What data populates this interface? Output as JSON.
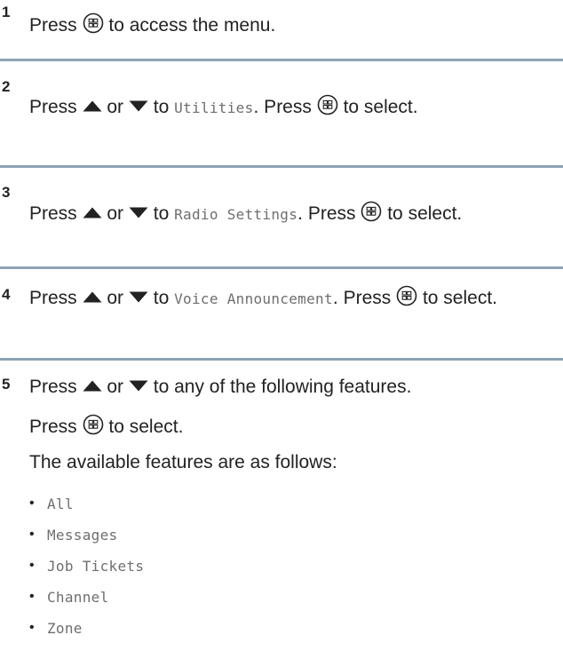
{
  "steps": [
    {
      "number": "1",
      "parts": {
        "a": "Press",
        "b": "to access the menu."
      }
    },
    {
      "number": "2",
      "parts": {
        "a": "Press",
        "b": "or",
        "c": "to",
        "menu": "Utilities",
        "d": ". Press",
        "e": "to select."
      }
    },
    {
      "number": "3",
      "parts": {
        "a": "Press",
        "b": "or",
        "c": "to",
        "menu": "Radio Settings",
        "d": ". Press",
        "e": "to select."
      }
    },
    {
      "number": "4",
      "parts": {
        "a": "Press",
        "b": "or",
        "c": "to",
        "menu": "Voice Announcement",
        "d": ". Press",
        "e": "to select."
      }
    },
    {
      "number": "5",
      "parts": {
        "a": "Press",
        "b": "or",
        "c": "to any of the following features.",
        "d": "Press",
        "e": "to select.",
        "f": "The available features are as follows:"
      },
      "features": [
        "All",
        "Messages",
        "Job Tickets",
        "Channel",
        "Zone"
      ]
    }
  ],
  "icons": {
    "menu_ok": "menu-ok-button-icon",
    "up": "up-arrow-icon",
    "down": "down-arrow-icon"
  },
  "colors": {
    "divider": "#8da3b6",
    "menu_text": "#6e6e6e",
    "text": "#222222"
  }
}
